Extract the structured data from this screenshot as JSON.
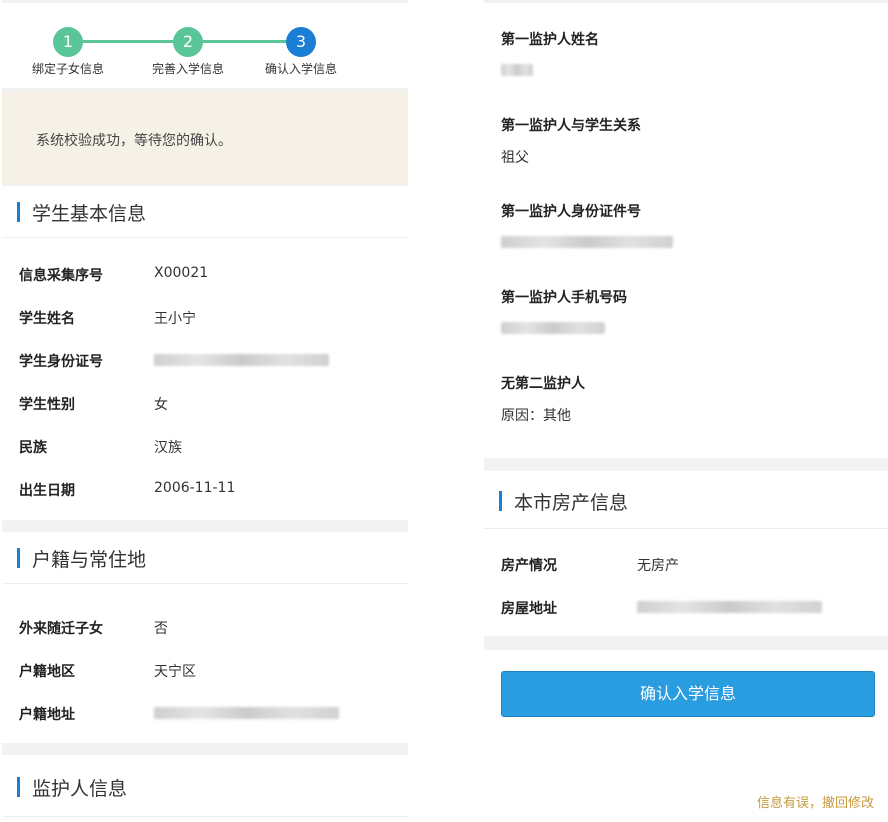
{
  "stepper": {
    "steps": [
      {
        "num": "1",
        "label": "绑定子女信息"
      },
      {
        "num": "2",
        "label": "完善入学信息"
      },
      {
        "num": "3",
        "label": "确认入学信息"
      }
    ]
  },
  "notice": {
    "text": "系统校验成功，等待您的确认。"
  },
  "student": {
    "title": "学生基本信息",
    "rows": [
      {
        "label": "信息采集序号",
        "value": "X00021"
      },
      {
        "label": "学生姓名",
        "value": "王小宁"
      },
      {
        "label": "学生身份证号",
        "value": ""
      },
      {
        "label": "学生性别",
        "value": "女"
      },
      {
        "label": "民族",
        "value": "汉族"
      },
      {
        "label": "出生日期",
        "value": "2006-11-11"
      }
    ]
  },
  "residence": {
    "title": "户籍与常住地",
    "rows": [
      {
        "label": "外来随迁子女",
        "value": "否"
      },
      {
        "label": "户籍地区",
        "value": "天宁区"
      },
      {
        "label": "户籍地址",
        "value": ""
      }
    ]
  },
  "guardian": {
    "title": "监护人信息",
    "items": [
      {
        "label": "第一监护人姓名",
        "value": ""
      },
      {
        "label": "第一监护人与学生关系",
        "value": "祖父"
      },
      {
        "label": "第一监护人身份证件号",
        "value": ""
      },
      {
        "label": "第一监护人手机号码",
        "value": ""
      },
      {
        "label": "无第二监护人",
        "value": "原因：其他"
      }
    ]
  },
  "property": {
    "title": "本市房产信息",
    "rows": [
      {
        "label": "房产情况",
        "value": "无房产"
      },
      {
        "label": "房屋地址",
        "value": ""
      }
    ]
  },
  "actions": {
    "confirm_label": "确认入学信息",
    "revoke_label": "信息有误，撤回修改"
  },
  "colors": {
    "accent": "#1a7fd4",
    "step_done": "#5bc59a",
    "button": "#2a9ce0",
    "link": "#c59a3c"
  }
}
